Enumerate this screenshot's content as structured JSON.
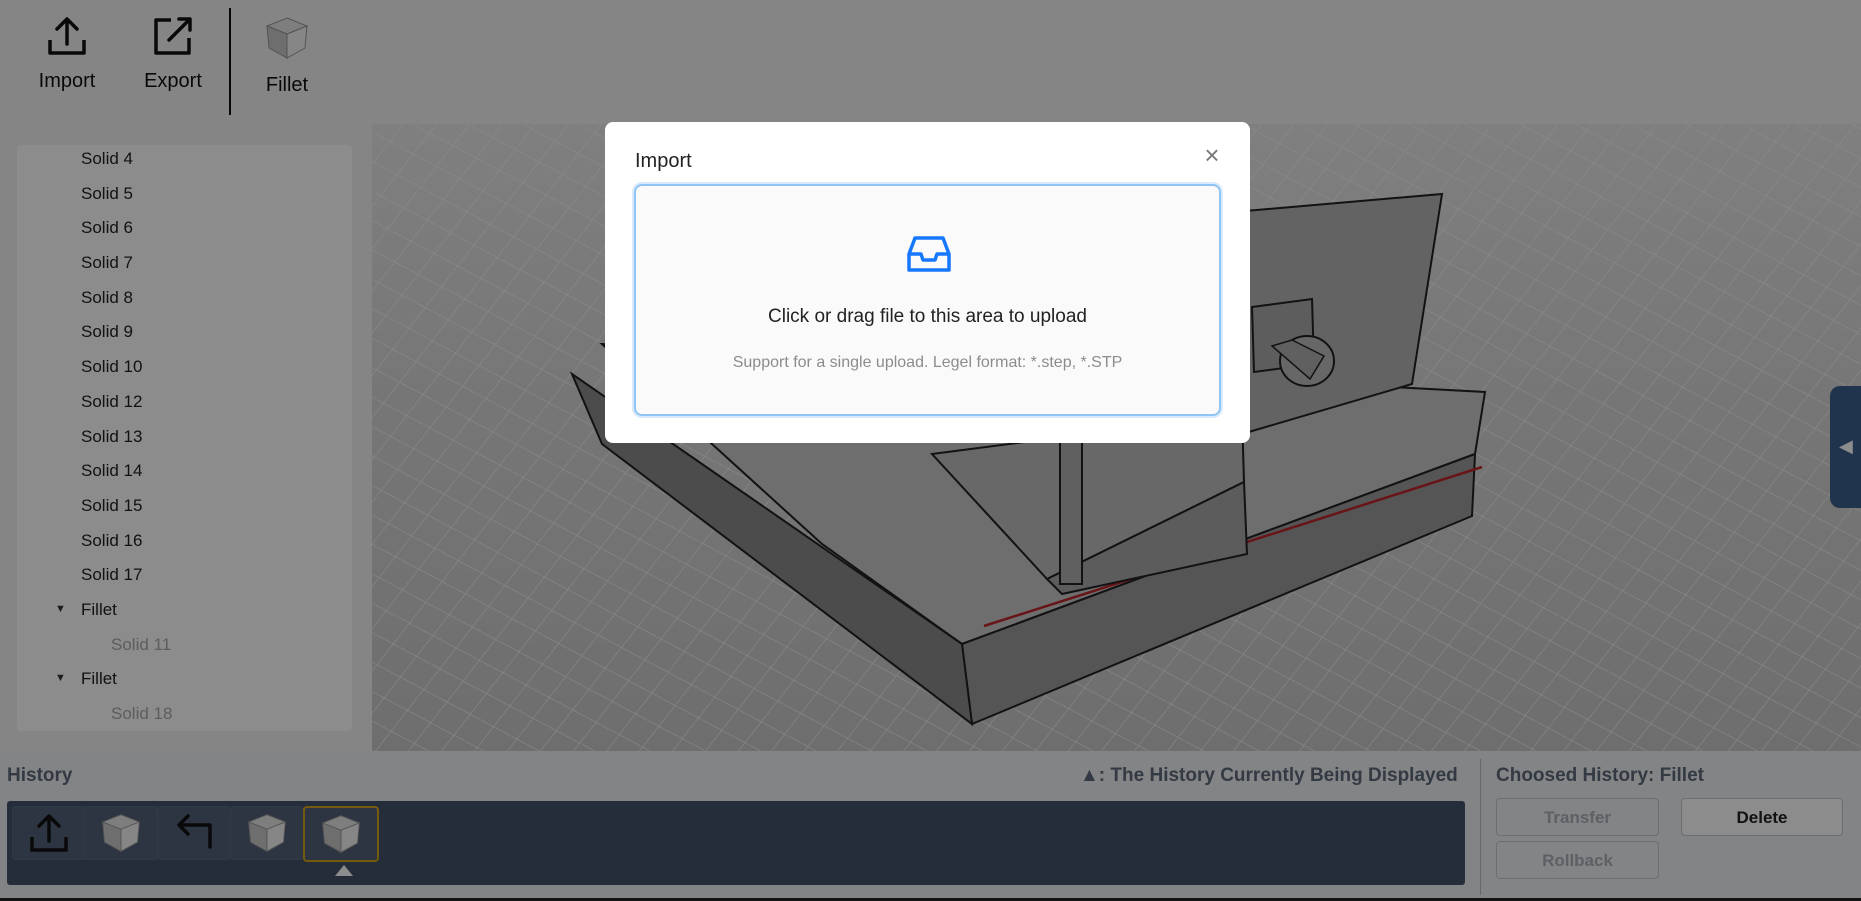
{
  "toolbar": {
    "import_label": "Import",
    "export_label": "Export",
    "fillet_label": "Fillet"
  },
  "tree": {
    "items": [
      {
        "label": "Solid 4"
      },
      {
        "label": "Solid 5"
      },
      {
        "label": "Solid 6"
      },
      {
        "label": "Solid 7"
      },
      {
        "label": "Solid 8"
      },
      {
        "label": "Solid 9"
      },
      {
        "label": "Solid 10"
      },
      {
        "label": "Solid 12"
      },
      {
        "label": "Solid 13"
      },
      {
        "label": "Solid 14"
      },
      {
        "label": "Solid 15"
      },
      {
        "label": "Solid 16"
      },
      {
        "label": "Solid 17"
      }
    ],
    "groups": [
      {
        "label": "Fillet",
        "child": "Solid 11"
      },
      {
        "label": "Fillet",
        "child": "Solid 18"
      }
    ]
  },
  "history": {
    "title": "History",
    "legend": "▲: The History Currently Being Displayed",
    "items": [
      {
        "icon": "upload-icon"
      },
      {
        "icon": "cube-icon"
      },
      {
        "icon": "undo-icon"
      },
      {
        "icon": "cube-icon"
      },
      {
        "icon": "cube-icon",
        "selected": true
      }
    ],
    "chosen_title": "Choosed History: Fillet",
    "transfer_label": "Transfer",
    "delete_label": "Delete",
    "rollback_label": "Rollback"
  },
  "modal": {
    "title": "Import",
    "close_icon": "×",
    "upload_text": "Click or drag file to this area to upload",
    "hint_text": "Support for a single upload. Legel format: *.step, *.STP"
  },
  "colors": {
    "accent": "#1677ff",
    "selected_history": "#d6a21c",
    "edge_highlight": "#c0272d"
  }
}
